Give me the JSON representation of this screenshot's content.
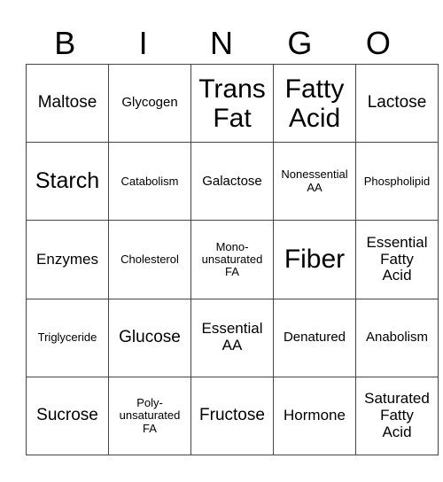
{
  "title_letters": [
    "B",
    "I",
    "N",
    "G",
    "O"
  ],
  "board": [
    [
      {
        "lines": [
          "Maltose"
        ],
        "size": "s19"
      },
      {
        "lines": [
          "Glycogen"
        ],
        "size": "s15"
      },
      {
        "lines": [
          "Trans",
          "Fat"
        ],
        "size": "s30"
      },
      {
        "lines": [
          "Fatty",
          "Acid"
        ],
        "size": "s30"
      },
      {
        "lines": [
          "Lactose"
        ],
        "size": "s19"
      }
    ],
    [
      {
        "lines": [
          "Starch"
        ],
        "size": "s25"
      },
      {
        "lines": [
          "Catabolism"
        ],
        "size": "s13"
      },
      {
        "lines": [
          "Galactose"
        ],
        "size": "s15"
      },
      {
        "lines": [
          "Nonessential",
          "AA"
        ],
        "size": "s13"
      },
      {
        "lines": [
          "Phospholipid"
        ],
        "size": "s13"
      }
    ],
    [
      {
        "lines": [
          "Enzymes"
        ],
        "size": "s17"
      },
      {
        "lines": [
          "Cholesterol"
        ],
        "size": "s13"
      },
      {
        "lines": [
          "Mono-",
          "unsaturated",
          "FA"
        ],
        "size": "s13"
      },
      {
        "lines": [
          "Fiber"
        ],
        "size": "s30"
      },
      {
        "lines": [
          "Essential",
          "Fatty",
          "Acid"
        ],
        "size": "s17"
      }
    ],
    [
      {
        "lines": [
          "Triglyceride"
        ],
        "size": "s13"
      },
      {
        "lines": [
          "Glucose"
        ],
        "size": "s19"
      },
      {
        "lines": [
          "Essential",
          "AA"
        ],
        "size": "s17"
      },
      {
        "lines": [
          "Denatured"
        ],
        "size": "s15"
      },
      {
        "lines": [
          "Anabolism"
        ],
        "size": "s15"
      }
    ],
    [
      {
        "lines": [
          "Sucrose"
        ],
        "size": "s19"
      },
      {
        "lines": [
          "Poly-",
          "unsaturated",
          "FA"
        ],
        "size": "s13"
      },
      {
        "lines": [
          "Fructose"
        ],
        "size": "s19"
      },
      {
        "lines": [
          "Hormone"
        ],
        "size": "s17"
      },
      {
        "lines": [
          "Saturated",
          "Fatty",
          "Acid"
        ],
        "size": "s17"
      }
    ]
  ]
}
